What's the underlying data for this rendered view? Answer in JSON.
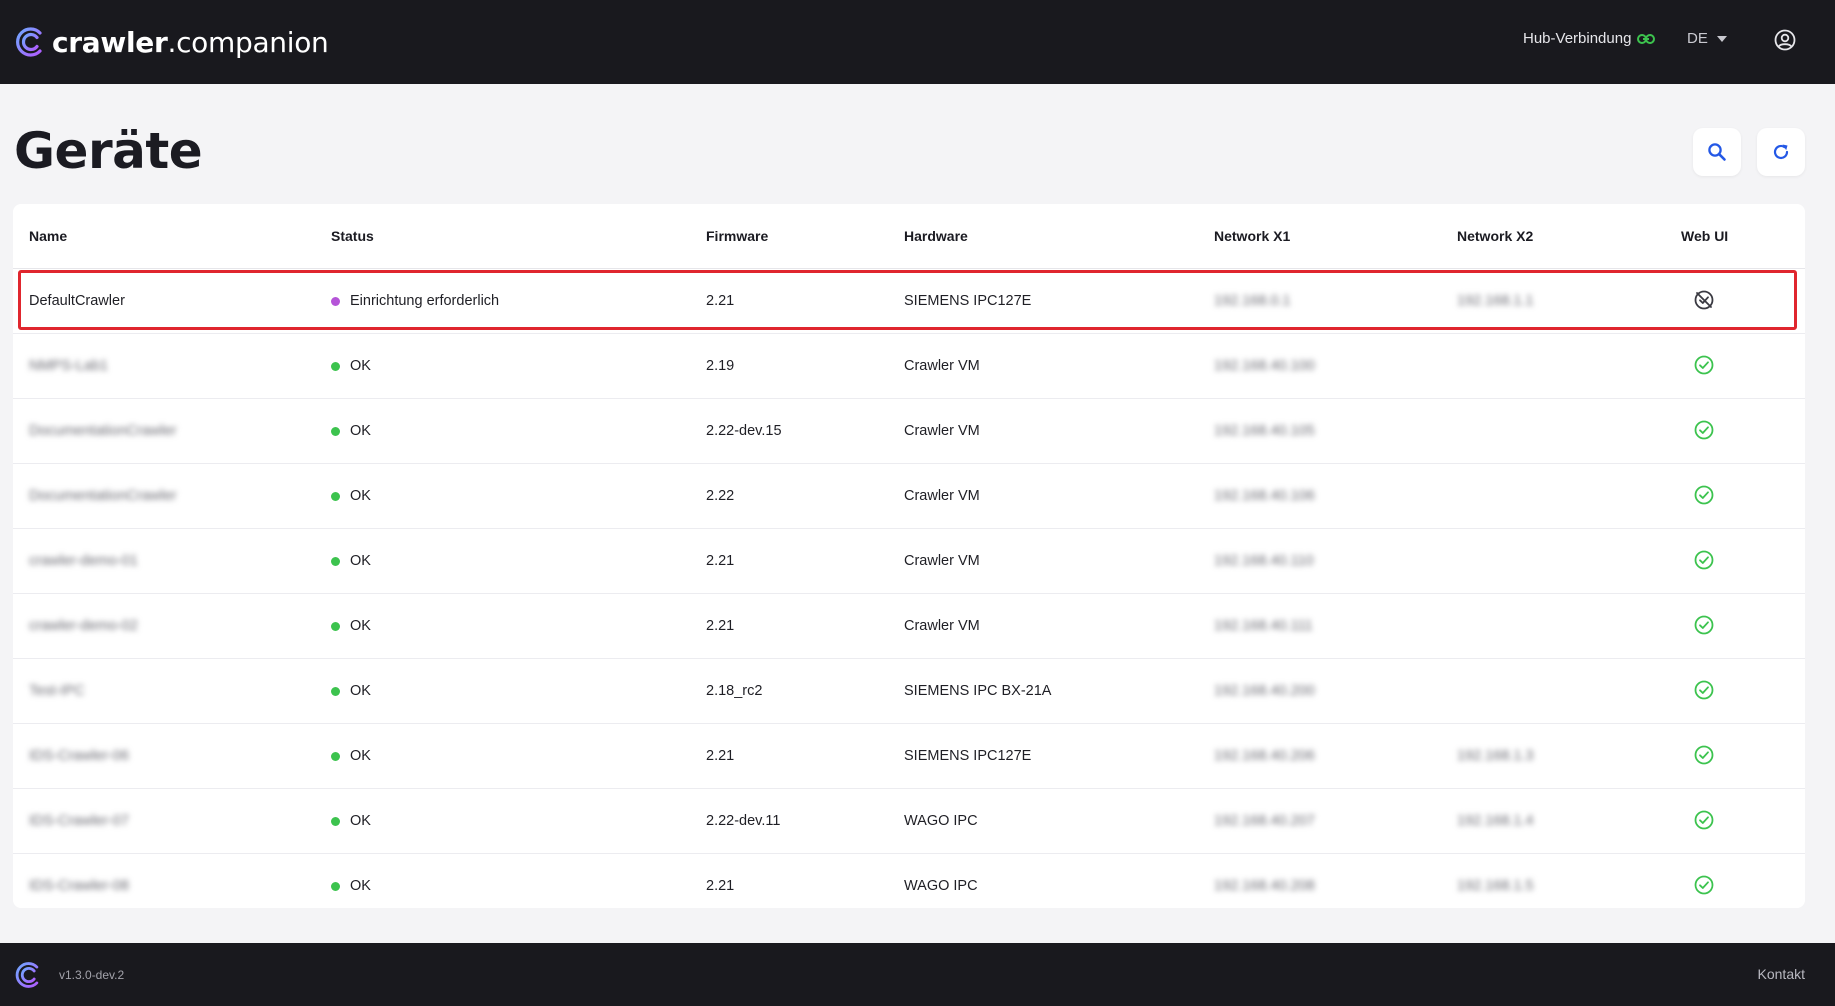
{
  "app": {
    "logo_bold": "crawler",
    "logo_rest": ".companion"
  },
  "header": {
    "hub_label": "Hub-Verbindung",
    "language": "DE",
    "hub_icon_color": "#3cc34e"
  },
  "page": {
    "title": "Geräte"
  },
  "table": {
    "columns": [
      "Name",
      "Status",
      "Firmware",
      "Hardware",
      "Network X1",
      "Network X2",
      "Web UI"
    ],
    "rows": [
      {
        "name": "DefaultCrawler",
        "status": "Einrichtung erforderlich",
        "status_type": "setup",
        "firmware": "2.21",
        "hardware": "SIEMENS IPC127E",
        "x1": "192.168.0.1",
        "x2": "192.168.1.1",
        "webui": "disabled-icon"
      },
      {
        "name": "NMPS-Lab1",
        "status": "OK",
        "status_type": "ok",
        "firmware": "2.19",
        "hardware": "Crawler VM",
        "x1": "192.168.40.100",
        "x2": "",
        "webui": "check-circle-icon"
      },
      {
        "name": "DocumentationCrawler",
        "status": "OK",
        "status_type": "ok",
        "firmware": "2.22-dev.15",
        "hardware": "Crawler VM",
        "x1": "192.168.40.105",
        "x2": "",
        "webui": "check-circle-icon"
      },
      {
        "name": "DocumentationCrawler",
        "status": "OK",
        "status_type": "ok",
        "firmware": "2.22",
        "hardware": "Crawler VM",
        "x1": "192.168.40.106",
        "x2": "",
        "webui": "check-circle-icon"
      },
      {
        "name": "crawler-demo-01",
        "status": "OK",
        "status_type": "ok",
        "firmware": "2.21",
        "hardware": "Crawler VM",
        "x1": "192.168.40.110",
        "x2": "",
        "webui": "check-circle-icon"
      },
      {
        "name": "crawler-demo-02",
        "status": "OK",
        "status_type": "ok",
        "firmware": "2.21",
        "hardware": "Crawler VM",
        "x1": "192.168.40.111",
        "x2": "",
        "webui": "check-circle-icon"
      },
      {
        "name": "Test-IPC",
        "status": "OK",
        "status_type": "ok",
        "firmware": "2.18_rc2",
        "hardware": "SIEMENS IPC BX-21A",
        "x1": "192.168.40.200",
        "x2": "",
        "webui": "check-circle-icon"
      },
      {
        "name": "IDS-Crawler-06",
        "status": "OK",
        "status_type": "ok",
        "firmware": "2.21",
        "hardware": "SIEMENS IPC127E",
        "x1": "192.168.40.206",
        "x2": "192.168.1.3",
        "webui": "check-circle-icon"
      },
      {
        "name": "IDS-Crawler-07",
        "status": "OK",
        "status_type": "ok",
        "firmware": "2.22-dev.11",
        "hardware": "WAGO IPC",
        "x1": "192.168.40.207",
        "x2": "192.168.1.4",
        "webui": "check-circle-icon"
      },
      {
        "name": "IDS-Crawler-08",
        "status": "OK",
        "status_type": "ok",
        "firmware": "2.21",
        "hardware": "WAGO IPC",
        "x1": "192.168.40.208",
        "x2": "192.168.1.5",
        "webui": "check-circle-icon"
      }
    ]
  },
  "footer": {
    "version": "v1.3.0-dev.2",
    "contact": "Kontakt"
  },
  "colors": {
    "header_bg": "#19191e",
    "status_ok": "#3cc34e",
    "status_setup": "#b554d8",
    "accent_blue": "#2458e6",
    "highlight": "#e0262e"
  }
}
